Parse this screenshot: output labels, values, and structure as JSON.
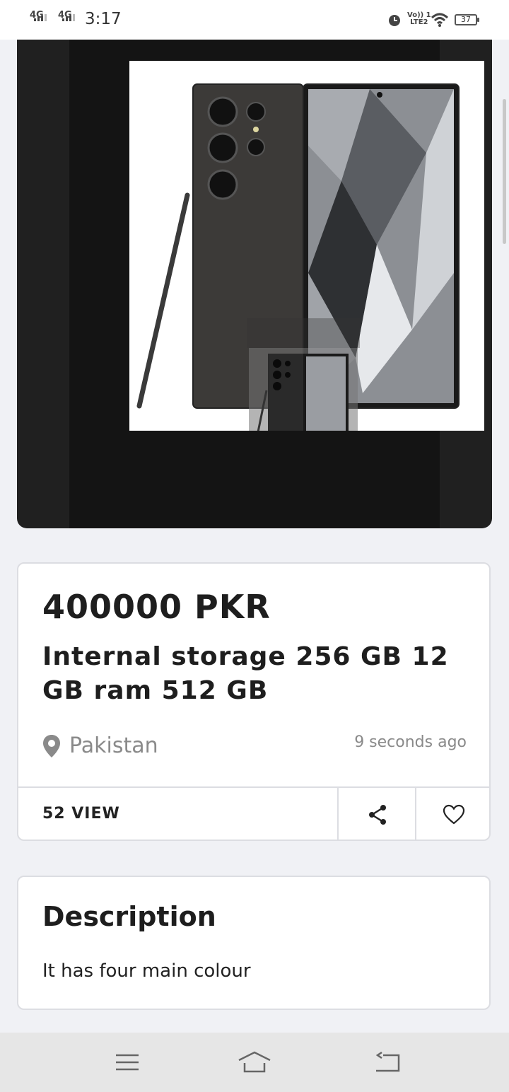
{
  "status_bar": {
    "network_1": "4G",
    "network_2": "4G",
    "time": "3:17",
    "volte_line1": "Vo)) 1",
    "volte_line2": "LTE2",
    "battery": "37"
  },
  "listing": {
    "price": "400000 PKR",
    "title": "Internal storage 256 GB 12 GB ram 512 GB",
    "location": "Pakistan",
    "posted": "9 seconds ago",
    "views": "52 VIEW"
  },
  "description": {
    "heading": "Description",
    "text": "It has four main colour"
  },
  "icons": {
    "location": "location-pin-icon",
    "share": "share-icon",
    "favorite": "heart-icon",
    "menu": "menu-icon",
    "home": "home-icon",
    "back": "back-icon"
  },
  "colors": {
    "page_bg": "#f0f1f5",
    "viewer_bg": "#202020",
    "text_primary": "#1e1e1e",
    "text_muted": "#8a8a8a"
  }
}
